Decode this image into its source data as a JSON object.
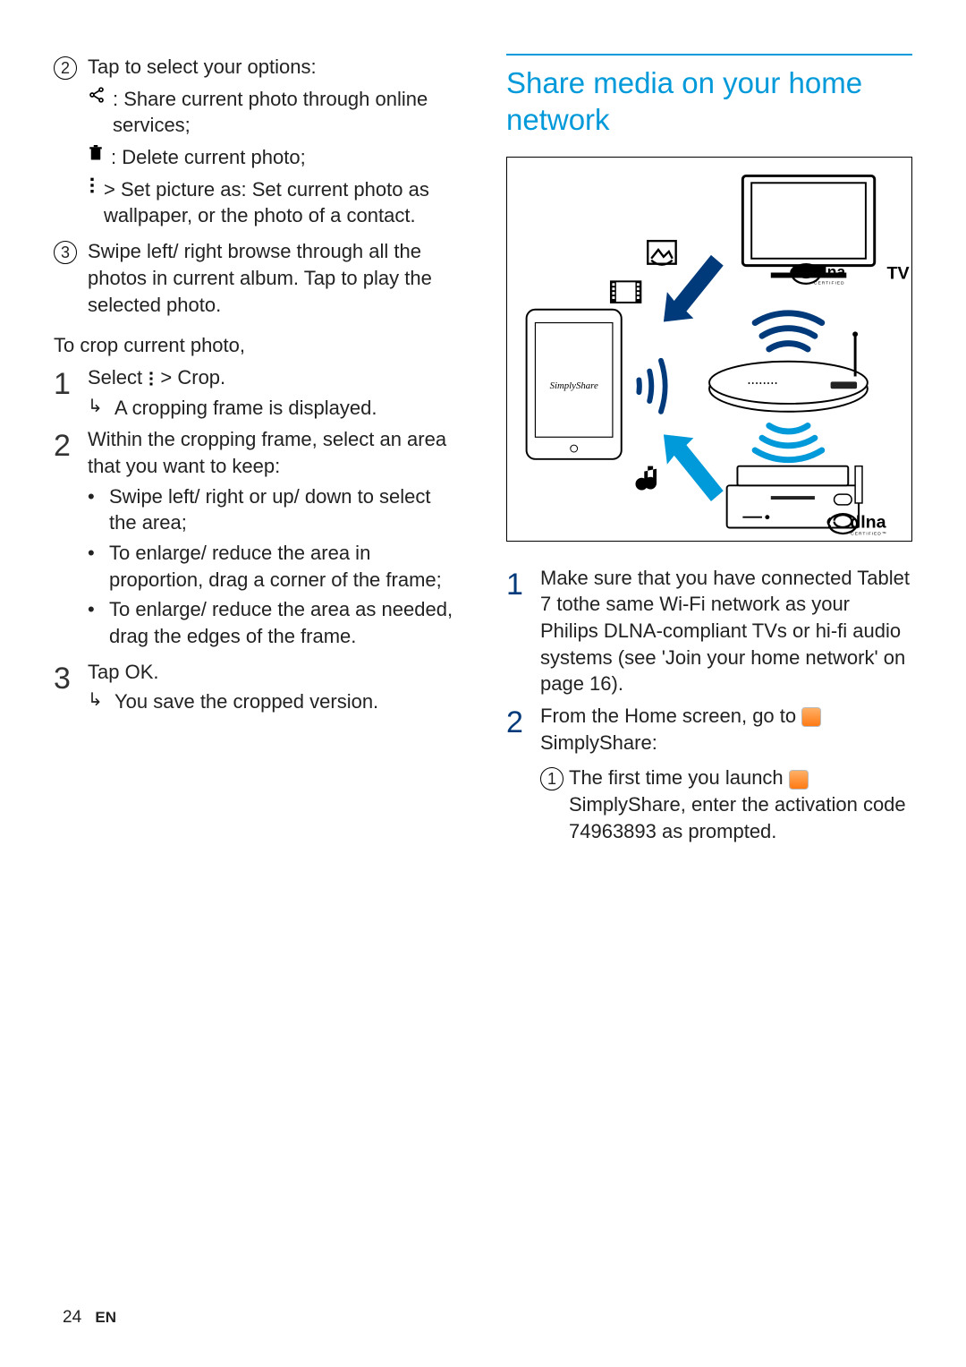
{
  "footer": {
    "page": "24",
    "lang": "EN"
  },
  "left": {
    "step2_lead": "Tap to select your options:",
    "share_text": ": Share current photo through online services;",
    "delete_text": ": Delete current photo;",
    "setpic_prefix": "> ",
    "setpic_bold": "Set picture as",
    "setpic_text": ": Set current photo as wallpaper, or the photo of a contact.",
    "step3": "Swipe left/ right browse through all the photos in current album. Tap to play the selected photo.",
    "crop_heading": "To crop current photo,",
    "crop1_prefix": "Select ",
    "crop1_suffix": " > ",
    "crop1_bold": "Crop",
    "crop1_end": ".",
    "crop1_result": "A cropping frame is displayed.",
    "crop2": "Within the cropping frame, select an area that you want to keep:",
    "crop2_b1": "Swipe left/ right or up/ down to select the area;",
    "crop2_b2": "To enlarge/ reduce the area in proportion, drag a corner of the frame;",
    "crop2_b3": "To enlarge/ reduce the area as needed, drag the edges of the frame.",
    "crop3_a": "Tap ",
    "crop3_b": "OK",
    "crop3_c": ".",
    "crop3_result": "You save the cropped version."
  },
  "right": {
    "heading": "Share media on your home network",
    "diagram": {
      "tablet_label": "SimplyShare",
      "tv_label": "TV",
      "dlna": "dlna"
    },
    "s1": "Make sure that you have connected Tablet 7 tothe same Wi-Fi network as your Philips DLNA-compliant TVs or hi-fi audio systems (see 'Join your home network' on page 16).",
    "s2_a": "From the Home screen, go to ",
    "s2_b": "SimplyShare",
    "s2_c": ":",
    "s2_sub_lead": "The first time you launch ",
    "s2_sub_body_a": "SimplyShare",
    "s2_sub_body_b": ", enter the activation code 74963893 as prompted."
  }
}
